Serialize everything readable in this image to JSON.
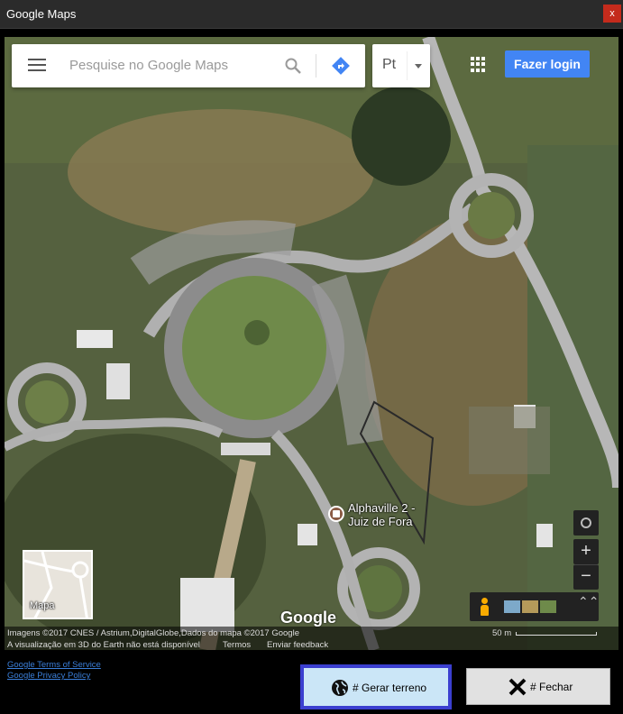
{
  "window": {
    "title": "Google Maps",
    "close_label": "x"
  },
  "map": {
    "search_placeholder": "Pesquise no Google Maps",
    "language": "Pt",
    "login_label": "Fazer login",
    "place_name": "Alphaville 2 - Juiz de Fora",
    "minimap_label": "Mapa",
    "zoom_in": "+",
    "zoom_out": "−",
    "expand": "⌃⌃",
    "logo_text": "Google",
    "attribution": "Imagens ©2017 CNES / Astrium,DigitalGlobe,Dados do mapa ©2017 Google",
    "notice_3d": "A visualização em 3D do Earth não está disponível",
    "terms_label": "Termos",
    "feedback_label": "Enviar feedback",
    "scale_label": "50 m",
    "colors": {
      "accent": "#4285f4",
      "poi": "#8a5a44"
    }
  },
  "footer": {
    "terms_link": "Google Terms of Service",
    "privacy_link": "Google Privacy Policy",
    "generate_label": "# Gerar terreno",
    "close_label": "# Fechar"
  }
}
